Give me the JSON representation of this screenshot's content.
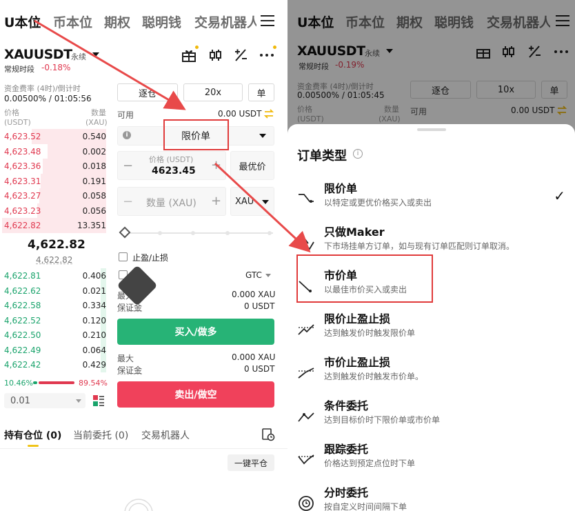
{
  "left": {
    "nav": {
      "tabs": [
        "U本位",
        "币本位",
        "期权",
        "聪明钱",
        "交易机器人"
      ],
      "active": 0
    },
    "symbol": "XAUUSDT",
    "perpetual": "永续",
    "session": "常规时段",
    "change": "-0.18%",
    "top_icons": [
      "gift-icon",
      "candlestick-icon",
      "calculator-icon",
      "more-icon"
    ],
    "funding_label": "资金费率 (4时)/倒计时",
    "funding_value": "0.00500% / 01:05:56",
    "margin_mode": "逐仓",
    "leverage": "20x",
    "single": "单",
    "order_book": {
      "price_header": "价格",
      "price_unit": "(USDT)",
      "qty_header": "数量",
      "qty_unit": "(XAU)",
      "asks": [
        {
          "price": "4,623.52",
          "qty": "0.540",
          "depth": 0.7
        },
        {
          "price": "4,623.48",
          "qty": "0.002",
          "depth": 0.55
        },
        {
          "price": "4,623.36",
          "qty": "0.018",
          "depth": 0.6
        },
        {
          "price": "4,623.31",
          "qty": "0.191",
          "depth": 0.62
        },
        {
          "price": "4,623.27",
          "qty": "0.058",
          "depth": 0.63
        },
        {
          "price": "4,623.23",
          "qty": "0.056",
          "depth": 0.65
        },
        {
          "price": "4,622.82",
          "qty": "13.351",
          "depth": 0.98
        }
      ],
      "last_price": "4,622.82",
      "mark_price": "4,622.82",
      "bids": [
        {
          "price": "4,622.81",
          "qty": "0.406",
          "depth": 0.05
        },
        {
          "price": "4,622.62",
          "qty": "0.021",
          "depth": 0.05
        },
        {
          "price": "4,622.58",
          "qty": "0.334",
          "depth": 0.05
        },
        {
          "price": "4,622.52",
          "qty": "0.120",
          "depth": 0.05
        },
        {
          "price": "4,622.50",
          "qty": "0.210",
          "depth": 0.05
        },
        {
          "price": "4,622.49",
          "qty": "0.064",
          "depth": 0.05
        },
        {
          "price": "4,622.42",
          "qty": "0.429",
          "depth": 0.05
        }
      ],
      "buy_ratio": "10.46%",
      "sell_ratio": "89.54%",
      "buy_fraction": 0.1046,
      "precision": "0.01"
    },
    "available_label": "可用",
    "available_value": "0.00 USDT",
    "order_type": "限价单",
    "price_label": "价格 (USDT)",
    "price_value": "4623.45",
    "best_price": "最优价",
    "qty_placeholder": "数量 (XAU)",
    "qty_unit": "XAU",
    "tpsl_label": "止盈/止损",
    "gtc": "GTC",
    "max_label": "最大",
    "max_value": "0.000 XAU",
    "margin_label": "保证金",
    "margin_value": "0 USDT",
    "buy_button": "买入/做多",
    "max_label2": "最大",
    "max_value2": "0.000 XAU",
    "margin_label2": "保证金",
    "margin_value2": "0 USDT",
    "sell_button": "卖出/做空",
    "bottom_tabs": [
      "持有仓位 (0)",
      "当前委托 (0)",
      "交易机器人"
    ],
    "close_all": "一键平仓"
  },
  "right": {
    "nav": {
      "tabs": [
        "U本位",
        "币本位",
        "期权",
        "聪明钱",
        "交易机器人"
      ],
      "active": 0
    },
    "symbol": "XAUUSDT",
    "perpetual": "永续",
    "session": "常规时段",
    "change": "-0.19%",
    "funding_label": "资金费率 (4时)/倒计时",
    "funding_value": "0.00500% / 01:05:45",
    "margin_mode": "逐仓",
    "leverage": "10x",
    "single": "单",
    "price_header": "价格",
    "price_unit": "(USDT)",
    "qty_header": "数量",
    "qty_unit": "(XAU)",
    "available_label": "可用",
    "available_value": "0.00 USDT",
    "sheet": {
      "title": "订单类型",
      "options": [
        {
          "name": "限价单",
          "desc": "以特定或更优价格买入或卖出",
          "icon": "limit-order-icon",
          "selected": true
        },
        {
          "name": "只做Maker",
          "desc": "下市场挂单方订单，如与现有订单匹配则订单取消。",
          "icon": "post-only-icon",
          "selected": false
        },
        {
          "name": "市价单",
          "desc": "以最佳市价买入或卖出",
          "icon": "market-order-icon",
          "selected": false
        },
        {
          "name": "限价止盈止损",
          "desc": "达到触发价时触发限价单",
          "icon": "limit-tpsl-icon",
          "selected": false
        },
        {
          "name": "市价止盈止损",
          "desc": "达到触发价时触发市价单。",
          "icon": "market-tpsl-icon",
          "selected": false
        },
        {
          "name": "条件委托",
          "desc": "达到目标价时下限价单或市价单",
          "icon": "conditional-icon",
          "selected": false
        },
        {
          "name": "跟踪委托",
          "desc": "价格达到预定点位时下单",
          "icon": "trailing-icon",
          "selected": false
        },
        {
          "name": "分时委托",
          "desc": "按自定义时间间隔下单",
          "icon": "twap-icon",
          "selected": false
        }
      ]
    }
  },
  "colors": {
    "red": "#e0384f",
    "green": "#19a36b",
    "annotation": "#e03a3a"
  }
}
